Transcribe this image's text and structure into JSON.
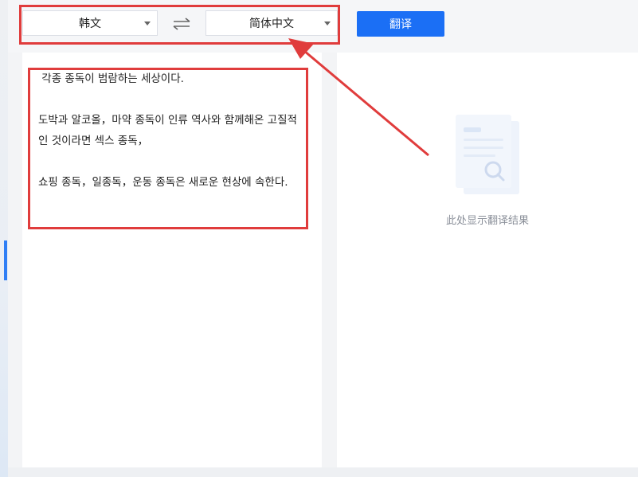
{
  "toolbar": {
    "source_lang": "韩文",
    "target_lang": "简体中文",
    "translate_label": "翻译"
  },
  "source": {
    "text": " 각종 종독이 범람하는 세상이다.\n\n도박과 알코올，마약 종독이 인류 역사와 함께해온 고질적인 것이라면 섹스 종독，\n\n쇼핑 종독，일종독，운동 종독은 새로운 현상에 속한다."
  },
  "result": {
    "placeholder": "此处显示翻译结果"
  },
  "colors": {
    "accent": "#1b6ff5",
    "highlight": "#e03c3c"
  }
}
